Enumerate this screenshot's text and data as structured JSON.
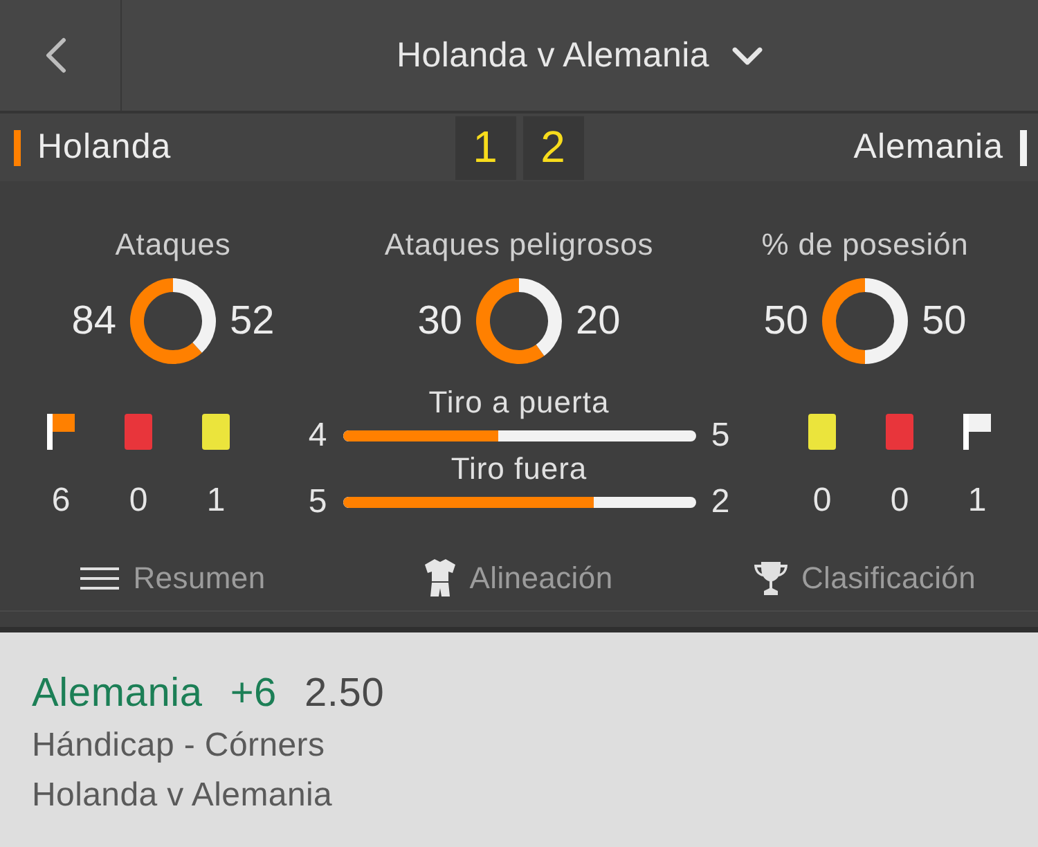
{
  "header": {
    "title": "Holanda v Alemania"
  },
  "scoreboard": {
    "teams": [
      {
        "name": "Holanda",
        "color": "#ff8000"
      },
      {
        "name": "Alemania",
        "color": "#f2f2f2"
      }
    ],
    "scores": [
      "1",
      "2"
    ]
  },
  "stats": {
    "donuts": [
      {
        "home": "84",
        "away": "52",
        "chart_data": {
          "type": "donut",
          "title": "Ataques",
          "values": [
            61.8,
            38.2
          ]
        }
      },
      {
        "home": "30",
        "away": "20",
        "chart_data": {
          "type": "donut",
          "title": "Ataques peligrosos",
          "values": [
            60,
            40
          ]
        }
      },
      {
        "home": "50",
        "away": "50",
        "chart_data": {
          "type": "donut",
          "title": "% de posesión",
          "values": [
            50,
            50
          ]
        }
      }
    ],
    "home_events": [
      {
        "kind": "corner",
        "count": "6"
      },
      {
        "kind": "red_card",
        "count": "0"
      },
      {
        "kind": "yellow_card",
        "count": "1"
      }
    ],
    "bars": [
      {
        "label": "Tiro a puerta",
        "home": "4",
        "away": "5",
        "level": 0.44
      },
      {
        "label": "Tiro fuera",
        "home": "5",
        "away": "2",
        "level": 0.71
      }
    ],
    "away_events": [
      {
        "kind": "yellow_card",
        "count": "0"
      },
      {
        "kind": "red_card",
        "count": "0"
      },
      {
        "kind": "corner",
        "count": "1"
      }
    ]
  },
  "tabs": [
    {
      "kind": "summary",
      "label": "Resumen",
      "selected": false
    },
    {
      "kind": "lineup",
      "label": "Alineación",
      "selected": false
    },
    {
      "kind": "standings",
      "label": "Clasificación",
      "selected": false
    }
  ],
  "bet": {
    "selection": "Alemania",
    "handicap": "+6",
    "odds": "2.50",
    "market": "Hándicap - Córners",
    "event": "Holanda v Alemania"
  }
}
